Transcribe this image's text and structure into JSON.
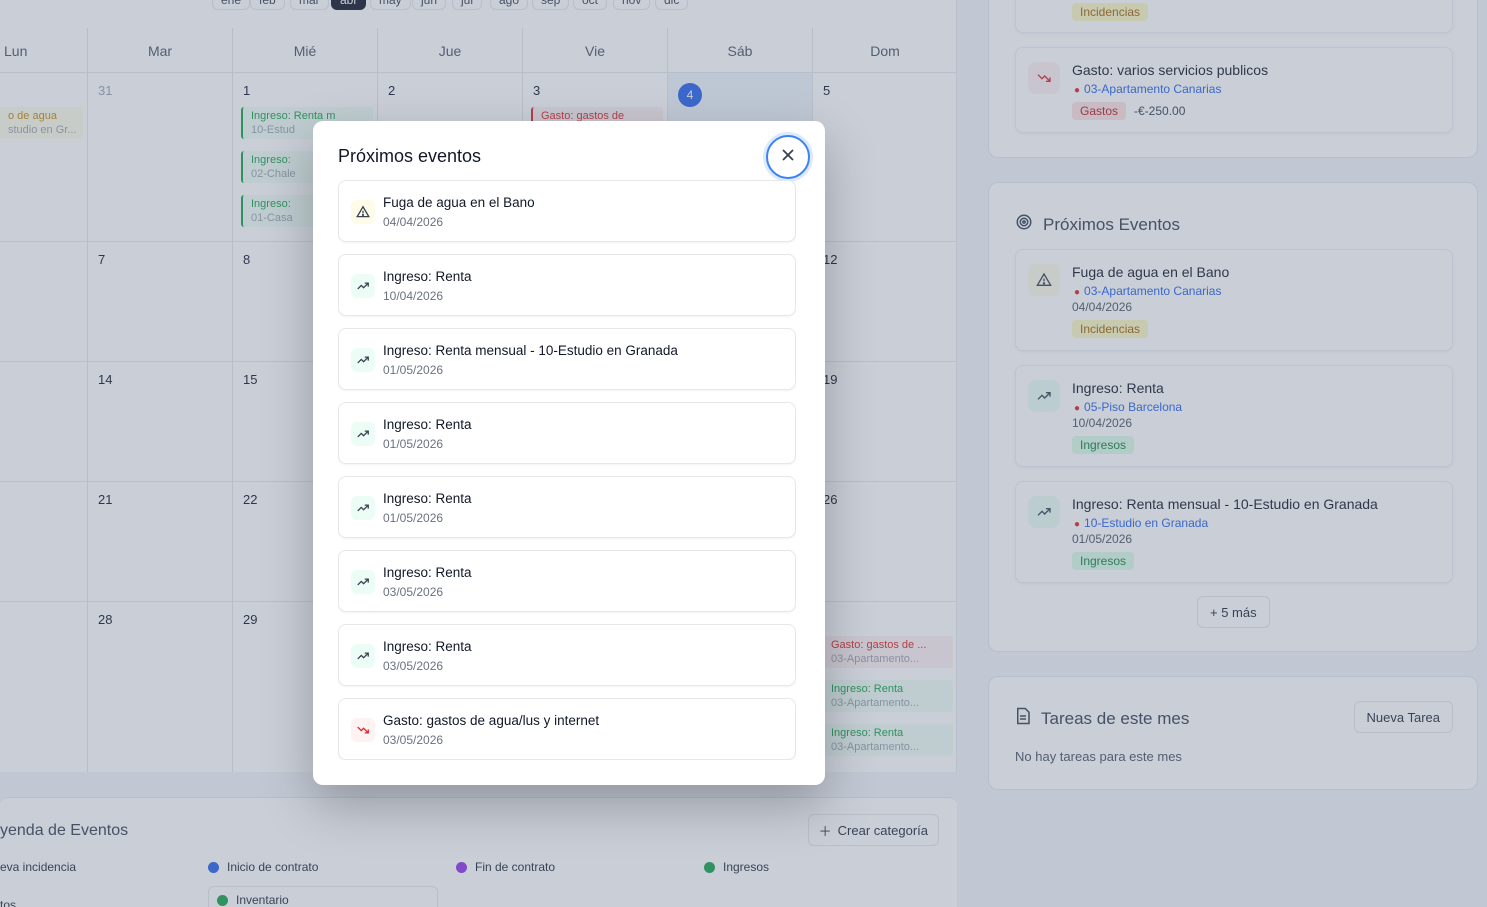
{
  "calendar": {
    "months": [
      {
        "label": "ene",
        "active": false
      },
      {
        "label": "feb",
        "active": false
      },
      {
        "label": "mar",
        "active": false
      },
      {
        "label": "abr",
        "active": true
      },
      {
        "label": "may",
        "active": false
      },
      {
        "label": "jun",
        "active": false
      },
      {
        "label": "jul",
        "active": false
      },
      {
        "label": "ago",
        "active": false
      },
      {
        "label": "sep",
        "active": false
      },
      {
        "label": "oct",
        "active": false
      },
      {
        "label": "nov",
        "active": false
      },
      {
        "label": "dic",
        "active": false
      }
    ],
    "days_of_week": [
      "Lun",
      "Mar",
      "Mié",
      "Jue",
      "Vie",
      "Sáb",
      "Dom"
    ],
    "weeks": [
      [
        "",
        "31",
        "1",
        "2",
        "3",
        "4",
        "5"
      ],
      [
        "",
        "7",
        "8",
        "",
        "",
        "",
        "12"
      ],
      [
        "",
        "14",
        "15",
        "",
        "",
        "",
        "19"
      ],
      [
        "",
        "21",
        "22",
        "",
        "",
        "",
        "26"
      ],
      [
        "",
        "28",
        "29",
        "",
        "",
        "",
        ""
      ]
    ],
    "cell_events": {
      "w0_lun": {
        "title": "o de agua",
        "sub": "studio en Gr..."
      },
      "w0_mie_1": {
        "title": "Ingreso: Renta m",
        "sub": "10-Estud"
      },
      "w0_mie_2": {
        "title": "Ingreso:",
        "sub": "02-Chale"
      },
      "w0_mie_3": {
        "title": "Ingreso:",
        "sub": "01-Casa"
      },
      "w0_vie_1": {
        "title": "Gasto: gastos de",
        "sub": ""
      },
      "w4_dom_1": {
        "title": "Gasto: gastos de ...",
        "sub": "03-Apartamento..."
      },
      "w4_dom_2": {
        "title": "Ingreso: Renta",
        "sub": "03-Apartamento..."
      },
      "w4_dom_3": {
        "title": "Ingreso: Renta",
        "sub": "03-Apartamento..."
      }
    }
  },
  "legend": {
    "title": "yenda de Eventos",
    "create_label": "Crear categoría",
    "items": [
      {
        "label": "eva incidencia",
        "color": "#eab308"
      },
      {
        "label": "Inicio de contrato",
        "color": "#2563eb"
      },
      {
        "label": "Fin de contrato",
        "color": "#9333ea"
      },
      {
        "label": "Ingresos",
        "color": "#16a34a"
      }
    ],
    "bottom_left": "tos",
    "inventory_label": "Inventario"
  },
  "sidebar": {
    "top_badge": "Incidencias",
    "top_card": {
      "title": "Gasto: varios servicios publicos",
      "location": "03-Apartamento Canarias",
      "badge": "Gastos",
      "amount": "-€-250.00"
    },
    "upcoming": {
      "title": "Próximos Eventos",
      "cards": [
        {
          "title": "Fuga de agua en el Bano",
          "location": "03-Apartamento Canarias",
          "date": "04/04/2026",
          "badge": "Incidencias",
          "kind": "ind"
        },
        {
          "title": "Ingreso: Renta",
          "location": "05-Piso Barcelona",
          "date": "10/04/2026",
          "badge": "Ingresos",
          "kind": "inc"
        },
        {
          "title": "Ingreso: Renta mensual - 10-Estudio en Granada",
          "location": "10-Estudio en Granada",
          "date": "01/05/2026",
          "badge": "Ingresos",
          "kind": "inc"
        }
      ],
      "more_label": "+ 5 más"
    },
    "tasks": {
      "title": "Tareas de este mes",
      "new_label": "Nueva Tarea",
      "empty": "No hay tareas para este mes"
    }
  },
  "modal": {
    "title": "Próximos eventos",
    "items": [
      {
        "title": "Fuga de agua en el Bano",
        "date": "04/04/2026",
        "kind": "warning"
      },
      {
        "title": "Ingreso: Renta",
        "date": "10/04/2026",
        "kind": "income"
      },
      {
        "title": "Ingreso: Renta mensual - 10-Estudio en Granada",
        "date": "01/05/2026",
        "kind": "income"
      },
      {
        "title": "Ingreso: Renta",
        "date": "01/05/2026",
        "kind": "income"
      },
      {
        "title": "Ingreso: Renta",
        "date": "01/05/2026",
        "kind": "income"
      },
      {
        "title": "Ingreso: Renta",
        "date": "03/05/2026",
        "kind": "income"
      },
      {
        "title": "Ingreso: Renta",
        "date": "03/05/2026",
        "kind": "income"
      },
      {
        "title": "Gasto: gastos de agua/lus y internet",
        "date": "03/05/2026",
        "kind": "expense"
      }
    ]
  },
  "colors": {
    "income": "#16a34a",
    "expense": "#dc2626",
    "warning": "#ca8a04",
    "accent": "#2563eb"
  }
}
